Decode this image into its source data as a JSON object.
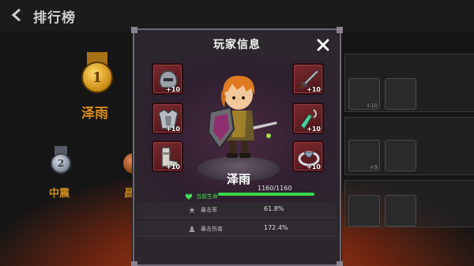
{
  "header": {
    "title": "排行榜"
  },
  "background": {
    "medal_1_number": "1",
    "medal_2_number": "2",
    "first_name": "泽雨",
    "second_name": "中震",
    "third_name_partial": "昌",
    "row_tags": [
      "+10",
      "+9"
    ]
  },
  "modal": {
    "title": "玩家信息",
    "player_name": "泽雨",
    "equipment_left": [
      {
        "icon": "helmet-icon",
        "level": "+10"
      },
      {
        "icon": "chest-armor-icon",
        "level": "+10"
      },
      {
        "icon": "boots-icon",
        "level": "+10"
      }
    ],
    "equipment_right": [
      {
        "icon": "sword-icon",
        "level": "+10"
      },
      {
        "icon": "amulet-icon",
        "level": "+10"
      },
      {
        "icon": "ring-icon",
        "level": "+10"
      }
    ],
    "hp": {
      "label": "当前生命",
      "value_text": "1160/1160",
      "current": 1160,
      "max": 1160
    },
    "stats": [
      {
        "icon": "crit-icon",
        "label": "暴击率",
        "value": "61.8%"
      },
      {
        "icon": "crit-damage-icon",
        "label": "暴击伤害",
        "value": "172.4%"
      }
    ]
  },
  "colors": {
    "hp_green": "#39d64a",
    "slot_red": "#7a2a2f",
    "gold": "#d88a1e"
  }
}
